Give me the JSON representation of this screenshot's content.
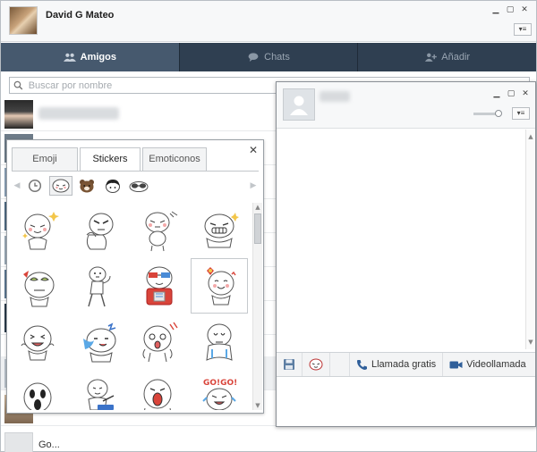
{
  "user": {
    "name": "David G Mateo"
  },
  "window_controls": {
    "minimize": "▁",
    "maximize": "▢",
    "close": "✕",
    "menu": "▾≡"
  },
  "tabs": [
    {
      "label": "Amigos",
      "icon": "friends-icon",
      "active": true
    },
    {
      "label": "Chats",
      "icon": "chat-bubble-icon",
      "active": false
    },
    {
      "label": "Añadir",
      "icon": "add-friend-icon",
      "active": false
    }
  ],
  "search": {
    "placeholder": "Buscar por nombre",
    "value": ""
  },
  "friends_list": {
    "last_visible_name": "Go..."
  },
  "sticker_panel": {
    "close": "✕",
    "tabs": [
      {
        "label": "Emoji",
        "active": false
      },
      {
        "label": "Stickers",
        "active": true
      },
      {
        "label": "Emoticonos",
        "active": false
      }
    ],
    "arrow_left": "◀",
    "arrow_right": "▶",
    "categories": [
      "clock-recent-icon",
      "moon-face-icon",
      "brown-bear-icon",
      "cony-girl-icon",
      "sunglasses-icon"
    ]
  },
  "chat_window": {
    "tool_buttons": {
      "save": "save-icon",
      "sticker": "sticker-face-icon",
      "call_label": "Llamada gratis",
      "video_label": "Videollamada"
    }
  },
  "colors": {
    "tabbar": "#2f3f51",
    "tab_active": "#46596e",
    "accent": "#e05a5a"
  }
}
